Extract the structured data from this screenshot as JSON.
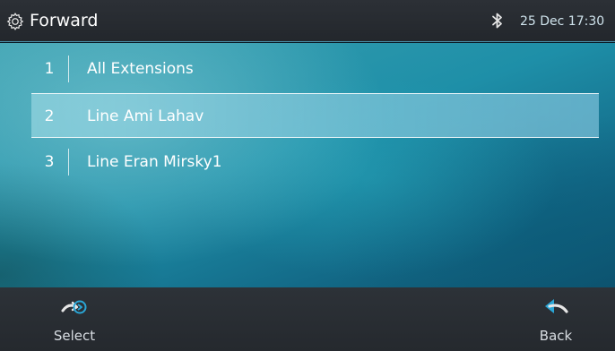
{
  "header": {
    "title": "Forward",
    "datetime": "25 Dec 17:30",
    "icons": {
      "settings": "gear-icon",
      "bluetooth": "bluetooth-icon"
    }
  },
  "list": {
    "items": [
      {
        "index": "1",
        "label": "All Extensions"
      },
      {
        "index": "2",
        "label": "Line  Ami Lahav",
        "selected": true
      },
      {
        "index": "3",
        "label": "Line  Eran Mirsky1"
      }
    ]
  },
  "softkeys": {
    "select": {
      "label": "Select",
      "icon": "select-arrow-icon"
    },
    "back": {
      "label": "Back",
      "icon": "back-arrow-icon"
    }
  },
  "colors": {
    "accent": "#2aa6d6",
    "header_bg": "#2c3036",
    "softbar_bg": "#2d3238",
    "content_bg": "#1e8fa8"
  }
}
